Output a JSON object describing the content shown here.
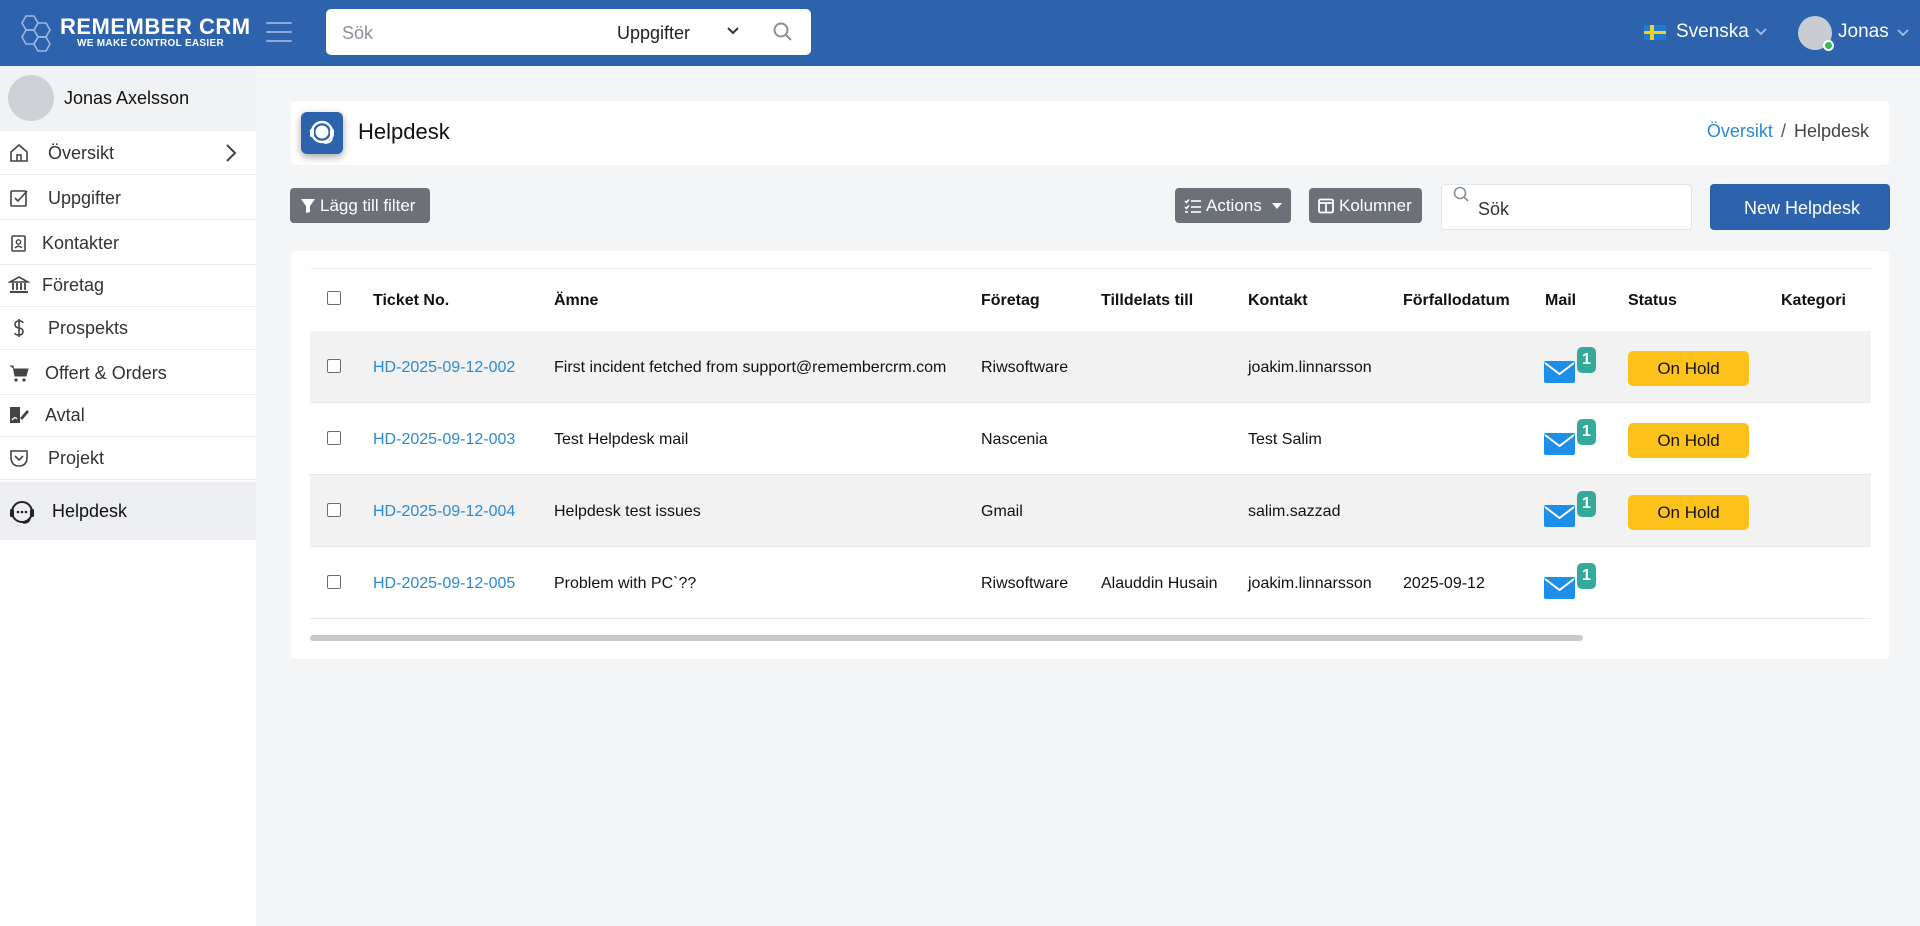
{
  "topbar": {
    "brand": "REMEMBER CRM",
    "tagline": "WE MAKE CONTROL EASIER",
    "search_placeholder": "Sök",
    "search_scope": "Uppgifter",
    "language": "Svenska",
    "user_name": "Jonas"
  },
  "sidebar": {
    "user_full_name": "Jonas Axelsson",
    "items": [
      {
        "label": "Översikt",
        "icon": "home-icon"
      },
      {
        "label": "Uppgifter",
        "icon": "checkbox-icon"
      },
      {
        "label": "Kontakter",
        "icon": "contacts-icon"
      },
      {
        "label": "Företag",
        "icon": "bank-icon"
      },
      {
        "label": "Prospekts",
        "icon": "dollar-icon"
      },
      {
        "label": "Offert & Orders",
        "icon": "cart-icon"
      },
      {
        "label": "Avtal",
        "icon": "signature-icon"
      },
      {
        "label": "Projekt",
        "icon": "pocket-icon"
      },
      {
        "label": "Helpdesk",
        "icon": "headset-icon"
      }
    ]
  },
  "header": {
    "title": "Helpdesk",
    "breadcrumb_link": "Översikt",
    "breadcrumb_sep": "/",
    "breadcrumb_current": "Helpdesk"
  },
  "toolbar": {
    "filter_label": "Lägg till filter",
    "actions_label": "Actions",
    "columns_label": "Kolumner",
    "search_placeholder": "Sök",
    "new_label": "New Helpdesk"
  },
  "table": {
    "columns": [
      "Ticket No.",
      "Ämne",
      "Företag",
      "Tilldelats till",
      "Kontakt",
      "Förfallodatum",
      "Mail",
      "Status",
      "Kategori"
    ],
    "rows": [
      {
        "ticket": "HD-2025-09-12-002",
        "subject": "First incident fetched from support@remembercrm.com",
        "company": "Riwsoftware",
        "assigned": "",
        "contact": "joakim.linnarsson",
        "due": "",
        "mail_count": "1",
        "status": "On Hold",
        "category": ""
      },
      {
        "ticket": "HD-2025-09-12-003",
        "subject": "Test Helpdesk mail",
        "company": "Nascenia",
        "assigned": "",
        "contact": "Test Salim",
        "due": "",
        "mail_count": "1",
        "status": "On Hold",
        "category": ""
      },
      {
        "ticket": "HD-2025-09-12-004",
        "subject": "Helpdesk test issues",
        "company": "Gmail",
        "assigned": "",
        "contact": "salim.sazzad",
        "due": "",
        "mail_count": "1",
        "status": "On Hold",
        "category": ""
      },
      {
        "ticket": "HD-2025-09-12-005",
        "subject": "Problem with PC`??",
        "company": "Riwsoftware",
        "assigned": "Alauddin Husain",
        "contact": "joakim.linnarsson",
        "due": "2025-09-12",
        "mail_count": "1",
        "status": "",
        "category": ""
      }
    ]
  },
  "colors": {
    "primary": "#2d62ad",
    "link": "#2a8ad6",
    "status_on_hold": "#fcc21b",
    "mail_icon": "#1e8fe8",
    "badge": "#35aa9c"
  }
}
